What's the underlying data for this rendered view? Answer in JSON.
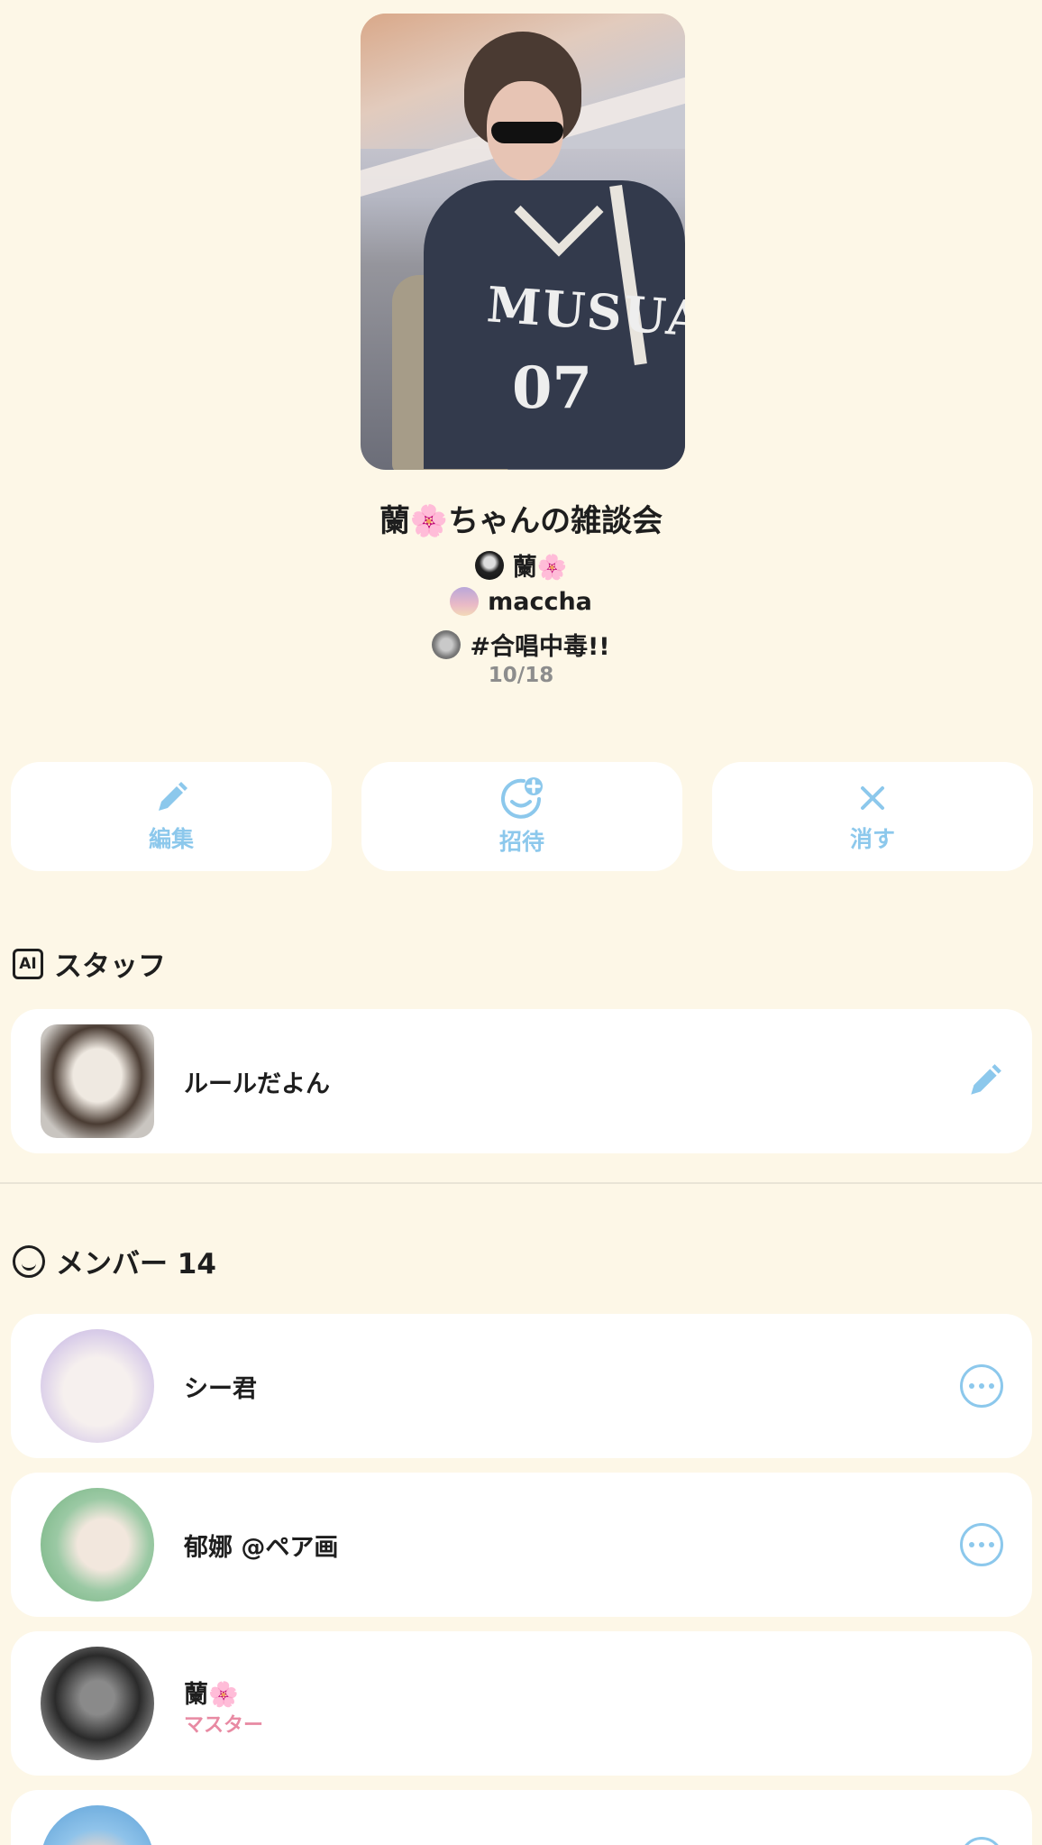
{
  "room": {
    "title": "蘭🌸ちゃんの雑談会",
    "host": "蘭🌸",
    "cohost": "maccha",
    "tag": "#合唱中毒!!",
    "count": "10/18"
  },
  "cover": {
    "logo": "MUSUAL",
    "number": "07"
  },
  "actions": [
    {
      "label": "編集",
      "icon": "pencil-icon"
    },
    {
      "label": "招待",
      "icon": "invite-smile-icon"
    },
    {
      "label": "消す",
      "icon": "close-icon"
    }
  ],
  "staff": {
    "heading": "スタッフ",
    "badge": "AI",
    "items": [
      {
        "name": "ルールだよん"
      }
    ]
  },
  "members": {
    "heading": "メンバー 14",
    "items": [
      {
        "name": "シー君"
      },
      {
        "name": "郁娜 @ペア画"
      },
      {
        "name": "蘭🌸",
        "role": "マスター"
      }
    ]
  },
  "colors": {
    "background": "#fdf7e7",
    "accent": "#8cc8ec",
    "master": "#e88aa3"
  }
}
